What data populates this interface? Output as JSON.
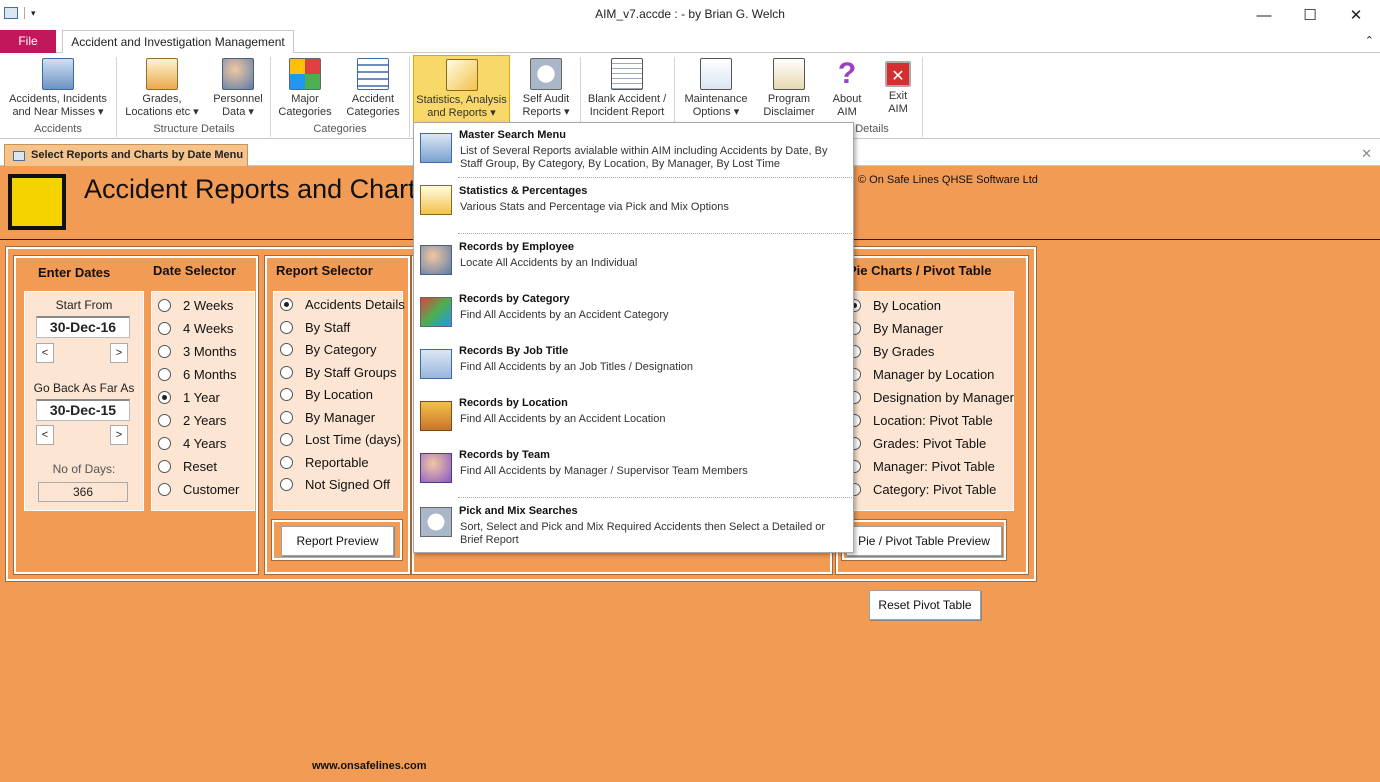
{
  "window": {
    "title": "AIM_v7.accde :  - by Brian G. Welch",
    "minimize": "—",
    "maximize": "☐",
    "close": "✕"
  },
  "tabs": {
    "file": "File",
    "home": "Accident and Investigation Management"
  },
  "ribbon": {
    "buttons": [
      {
        "label": "Accidents, Incidents",
        "label2": "and Near Misses ▾"
      },
      {
        "label": "Grades,",
        "label2": "Locations etc ▾"
      },
      {
        "label": "Personnel",
        "label2": "Data ▾"
      },
      {
        "label": "Major",
        "label2": "Categories"
      },
      {
        "label": "Accident",
        "label2": "Categories"
      },
      {
        "label": "Statistics, Analysis",
        "label2": "and Reports ▾"
      },
      {
        "label": "Self Audit",
        "label2": "Reports ▾"
      },
      {
        "label": "Blank Accident /",
        "label2": "Incident Report"
      },
      {
        "label": "Maintenance",
        "label2": "Options ▾"
      },
      {
        "label": "Program",
        "label2": "Disclaimer"
      },
      {
        "label": "About",
        "label2": "AIM"
      },
      {
        "label": "Exit",
        "label2": "AIM"
      }
    ],
    "groups": {
      "accidents": "Accidents",
      "structure": "Structure Details",
      "categories": "Categories",
      "details": "Details"
    }
  },
  "doc_tab": {
    "label": "Select Reports and Charts by Date Menu",
    "close": "✕"
  },
  "form": {
    "title": "Accident Reports and Charts",
    "copyright": "© On Safe Lines QHSE Software Ltd",
    "enter_dates": {
      "heading": "Enter Dates",
      "start_label": "Start From",
      "start_value": "30-Dec-16",
      "back_label": "Go Back As Far As",
      "back_value": "30-Dec-15",
      "prev": "<",
      "next": ">",
      "days_label": "No of Days:",
      "days_value": "366"
    },
    "date_selector": {
      "heading": "Date Selector",
      "options": [
        "2  Weeks",
        "4  Weeks",
        "3 Months",
        "6 Months",
        "1 Year",
        "2 Years",
        "4 Years",
        "Reset",
        "Customer"
      ],
      "selected": 4
    },
    "report_selector": {
      "heading": "Report Selector",
      "options": [
        "Accidents Details",
        "By Staff",
        "By Category",
        "By Staff Groups",
        "By Location",
        "By Manager",
        "Lost Time (days)",
        "Reportable",
        "Not Signed Off"
      ],
      "selected": 0,
      "button": "Report Preview"
    },
    "pie_charts": {
      "heading": "Pie Charts / Pivot Table",
      "options": [
        "By Location",
        "By Manager",
        "By Grades",
        "Manager by Location",
        "Designation by Manager",
        "Location: Pivot Table",
        "Grades: Pivot Table",
        "Manager: Pivot Table",
        "Category: Pivot Table"
      ],
      "selected": 0,
      "button": "Pie / Pivot Table  Preview",
      "reset": "Reset Pivot Table"
    },
    "footer_url": "www.onsafelines.com"
  },
  "menu": {
    "items": [
      {
        "title": "Master Search Menu",
        "desc": "List of Several Reports avialable within AIM including Accidents by Date, By Staff Group, By Category, By Location, By Manager, By Lost Time"
      },
      {
        "title": "Statistics & Percentages",
        "desc": "Various Stats and Percentage via Pick and Mix Options"
      },
      {
        "title": "Records by Employee",
        "desc": "Locate All Accidents by an Individual"
      },
      {
        "title": "Records by Category",
        "desc": "Find All Accidents by an Accident Category"
      },
      {
        "title": "Records By Job Title",
        "desc": "Find All Accidents by an Job Titles / Designation"
      },
      {
        "title": "Records by Location",
        "desc": "Find All Accidents by an Accident Location"
      },
      {
        "title": "Records by Team",
        "desc": "Find All Accidents by Manager / Supervisor Team Members"
      },
      {
        "title": "Pick and Mix Searches",
        "desc": "Sort, Select and Pick and Mix Required Accidents then Select a Detailed or Brief Report"
      }
    ]
  }
}
